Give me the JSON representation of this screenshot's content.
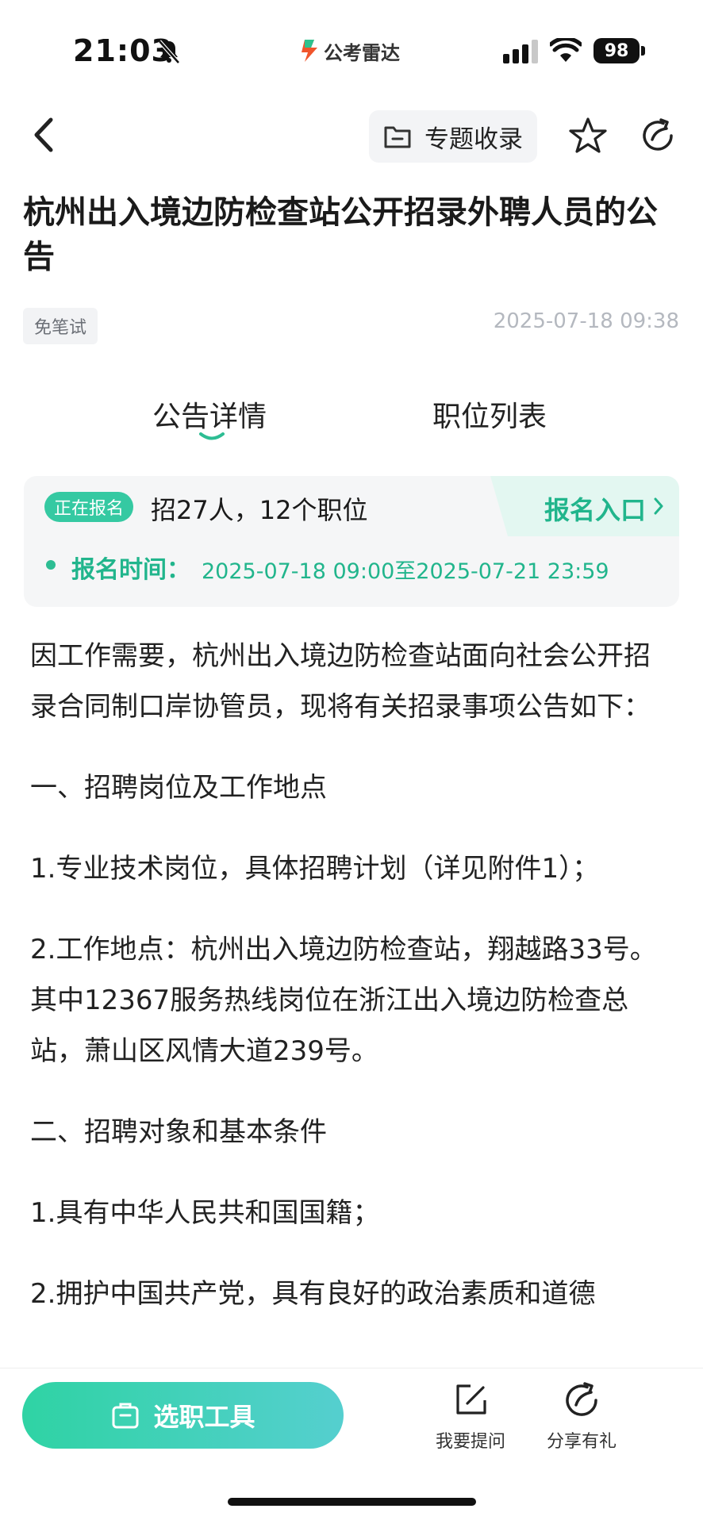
{
  "status_bar": {
    "time": "21:03",
    "battery": "98",
    "app_name": "公考雷达"
  },
  "nav": {
    "topic_button_label": "专题收录"
  },
  "announcement": {
    "title": "杭州出入境边防检查站公开招录外聘人员的公告",
    "tag": "免笔试",
    "publish_time": "2025-07-18 09:38"
  },
  "tabs": [
    {
      "label": "公告详情",
      "active": true
    },
    {
      "label": "职位列表",
      "active": false
    }
  ],
  "signup": {
    "status": "正在报名",
    "quota": "招27人，12个职位",
    "entry_label": "报名入口",
    "time_label": "报名时间：",
    "time_value": "2025-07-18 09:00至2025-07-21 23:59"
  },
  "article": {
    "paragraphs": [
      "因工作需要，杭州出入境边防检查站面向社会公开招录合同制口岸协管员，现将有关招录事项公告如下：",
      "一、招聘岗位及工作地点",
      "1.专业技术岗位，具体招聘计划（详见附件1）；",
      "2.工作地点：杭州出入境边防检查站，翔越路33号。 其中12367服务热线岗位在浙江出入境边防检查总站，萧山区风情大道239号。",
      "二、招聘对象和基本条件",
      "1.具有中华人民共和国国籍；",
      "2.拥护中国共产党，具有良好的政治素质和道德"
    ]
  },
  "bottom_bar": {
    "tool_button_label": "选职工具",
    "ask_label": "我要提问",
    "share_label": "分享有礼"
  },
  "colors": {
    "accent": "#21b58c",
    "pill": "#35c9a2",
    "entry_bg": "#e3f7f1"
  }
}
